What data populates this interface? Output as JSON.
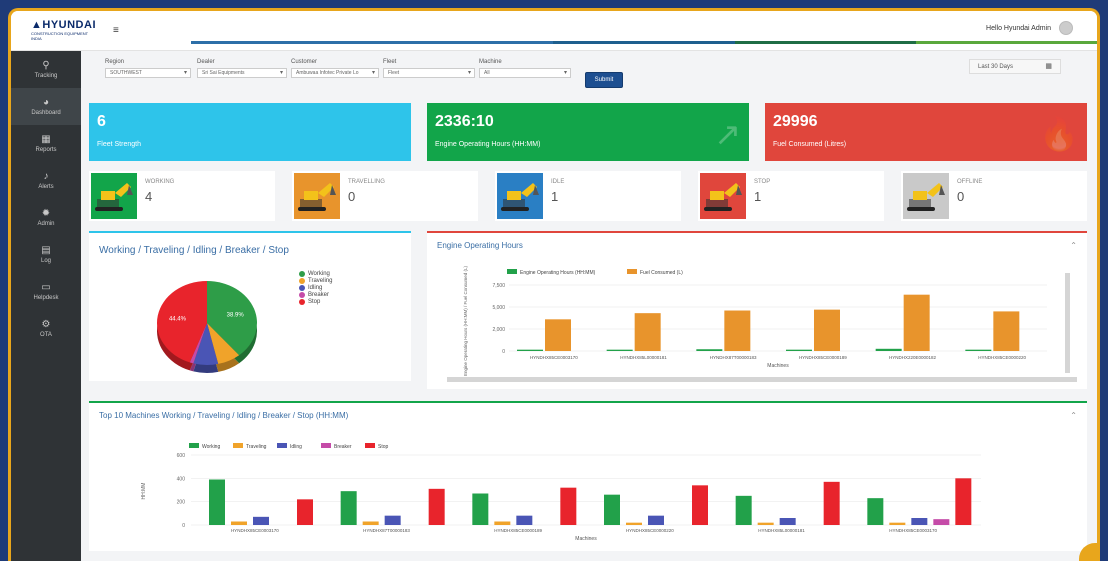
{
  "logo": {
    "brand": "▲HYUNDAI",
    "sub1": "CONSTRUCTION EQUIPMENT",
    "sub2": "INDIA"
  },
  "header": {
    "menu_icon": "hamburger-icon",
    "greeting": "Hello Hyundai Admin"
  },
  "sidebar": {
    "items": [
      {
        "label": "Tracking",
        "icon": "location-pin-icon",
        "glyph": "⚲"
      },
      {
        "label": "Dashboard",
        "icon": "dashboard-icon",
        "glyph": "◕"
      },
      {
        "label": "Reports",
        "icon": "grid-icon",
        "glyph": "▦"
      },
      {
        "label": "Alerts",
        "icon": "bell-icon",
        "glyph": "♪"
      },
      {
        "label": "Admin",
        "icon": "gear-icon",
        "glyph": "✹"
      },
      {
        "label": "Log",
        "icon": "log-icon",
        "glyph": "▤"
      },
      {
        "label": "Helpdesk",
        "icon": "monitor-icon",
        "glyph": "▭"
      },
      {
        "label": "OTA",
        "icon": "gears-icon",
        "glyph": "⚙"
      }
    ]
  },
  "filters": {
    "region": {
      "label": "Region",
      "value": "SOUTHWEST"
    },
    "dealer": {
      "label": "Dealer",
      "value": "Sri Sai Equipments"
    },
    "customer": {
      "label": "Customer",
      "value": "Ambuwaa Infotec Private Lo"
    },
    "fleet": {
      "label": "Fleet",
      "value": "Fleet"
    },
    "machine": {
      "label": "Machine",
      "value": "All"
    },
    "submit_label": "Submit",
    "date_range": "Last 30 Days"
  },
  "kpis": [
    {
      "value": "6",
      "label": "Fleet Strength",
      "color": "#2ec4ea",
      "icon": ""
    },
    {
      "value": "2336:10",
      "label": "Engine Operating Hours (HH:MM)",
      "color": "#12a54a",
      "icon": "↗"
    },
    {
      "value": "29996",
      "label": "Fuel Consumed (Litres)",
      "color": "#e0463c",
      "icon": "🔥"
    }
  ],
  "statuses": [
    {
      "label": "WORKING",
      "value": "4",
      "color": "#12a54a"
    },
    {
      "label": "TRAVELLING",
      "value": "0",
      "color": "#e8942c"
    },
    {
      "label": "IDLE",
      "value": "1",
      "color": "#2a7fc4"
    },
    {
      "label": "STOP",
      "value": "1",
      "color": "#e0463c"
    },
    {
      "label": "OFFLINE",
      "value": "0",
      "color": "#c9c9c9"
    }
  ],
  "pie_panel": {
    "title": "Working / Traveling / Idling / Breaker / Stop",
    "legend": [
      {
        "name": "Working",
        "color": "#2e9d48"
      },
      {
        "name": "Traveling",
        "color": "#f0a32a"
      },
      {
        "name": "Idling",
        "color": "#4a55b5"
      },
      {
        "name": "Breaker",
        "color": "#c54ba8"
      },
      {
        "name": "Stop",
        "color": "#e8242c"
      }
    ]
  },
  "engine_panel": {
    "title": "Engine Operating Hours",
    "legend": [
      {
        "name": "Engine Operating Hours (HH:MM)",
        "color": "#22a14a"
      },
      {
        "name": "Fuel Consumed (L)",
        "color": "#e8942c"
      }
    ],
    "ylabel": "Engine Operating Hours (HH:MM) / Fuel Consumed (L)",
    "xlabel": "Machines"
  },
  "top10_panel": {
    "title": "Top 10 Machines Working / Traveling / Idling / Breaker / Stop (HH:MM)",
    "ylabel": "HH:MM",
    "xlabel": "Machines"
  },
  "chart_data": [
    {
      "type": "pie",
      "title": "Working / Traveling / Idling / Breaker / Stop",
      "categories": [
        "Working",
        "Traveling",
        "Idling",
        "Breaker",
        "Stop"
      ],
      "values": [
        38.9,
        7.5,
        8.0,
        1.2,
        44.4
      ],
      "data_labels": [
        "38.9%",
        "",
        "",
        "",
        "44.4%"
      ],
      "colors": [
        "#2e9d48",
        "#f0a32a",
        "#4a55b5",
        "#c54ba8",
        "#e8242c"
      ],
      "legend_position": "right"
    },
    {
      "type": "bar",
      "title": "Engine Operating Hours",
      "categories": [
        "HYNDHX85CE0003170",
        "HYNDHX85L00000181",
        "HYNDHX87T00000183",
        "HYNDHX85CE0000189",
        "HYNDHX220E0000182",
        "HYNDHX85CE0000220"
      ],
      "series": [
        {
          "name": "Engine Operating Hours (HH:MM)",
          "values": [
            150,
            150,
            200,
            150,
            250,
            150
          ]
        },
        {
          "name": "Fuel Consumed (L)",
          "values": [
            3600,
            4300,
            4600,
            4700,
            6400,
            4500
          ]
        }
      ],
      "yticks": [
        "0",
        "2,000",
        "5,000",
        "7,500"
      ],
      "ylim": [
        0,
        7500
      ],
      "xlabel": "Machines",
      "ylabel": "Engine Operating Hours (HH:MM) / Fuel Consumed (L)",
      "legend_position": "top"
    },
    {
      "type": "bar",
      "title": "Top 10 Machines Working / Traveling / Idling / Breaker / Stop (HH:MM)",
      "categories": [
        "HYNDHX85CE0003170",
        "HYNDHX87T00000183",
        "HYNDHX85CE0000189",
        "HYNDHX85CE0000220",
        "HYNDHX85L00000181",
        "HYNDHX85CE0003170"
      ],
      "series": [
        {
          "name": "Working",
          "values": [
            390,
            290,
            270,
            260,
            250,
            230
          ]
        },
        {
          "name": "Traveling",
          "values": [
            30,
            30,
            30,
            20,
            20,
            20
          ]
        },
        {
          "name": "Idling",
          "values": [
            70,
            80,
            80,
            80,
            60,
            60
          ]
        },
        {
          "name": "Breaker",
          "values": [
            0,
            0,
            0,
            0,
            0,
            50
          ]
        },
        {
          "name": "Stop",
          "values": [
            220,
            310,
            320,
            340,
            370,
            400
          ]
        }
      ],
      "colors": [
        "#22a14a",
        "#f0a32a",
        "#4a55b5",
        "#c54ba8",
        "#e8242c"
      ],
      "yticks": [
        "0",
        "200",
        "400",
        "600"
      ],
      "ylim": [
        0,
        600
      ],
      "xlabel": "Machines",
      "ylabel": "HH:MM",
      "legend_position": "top"
    }
  ]
}
